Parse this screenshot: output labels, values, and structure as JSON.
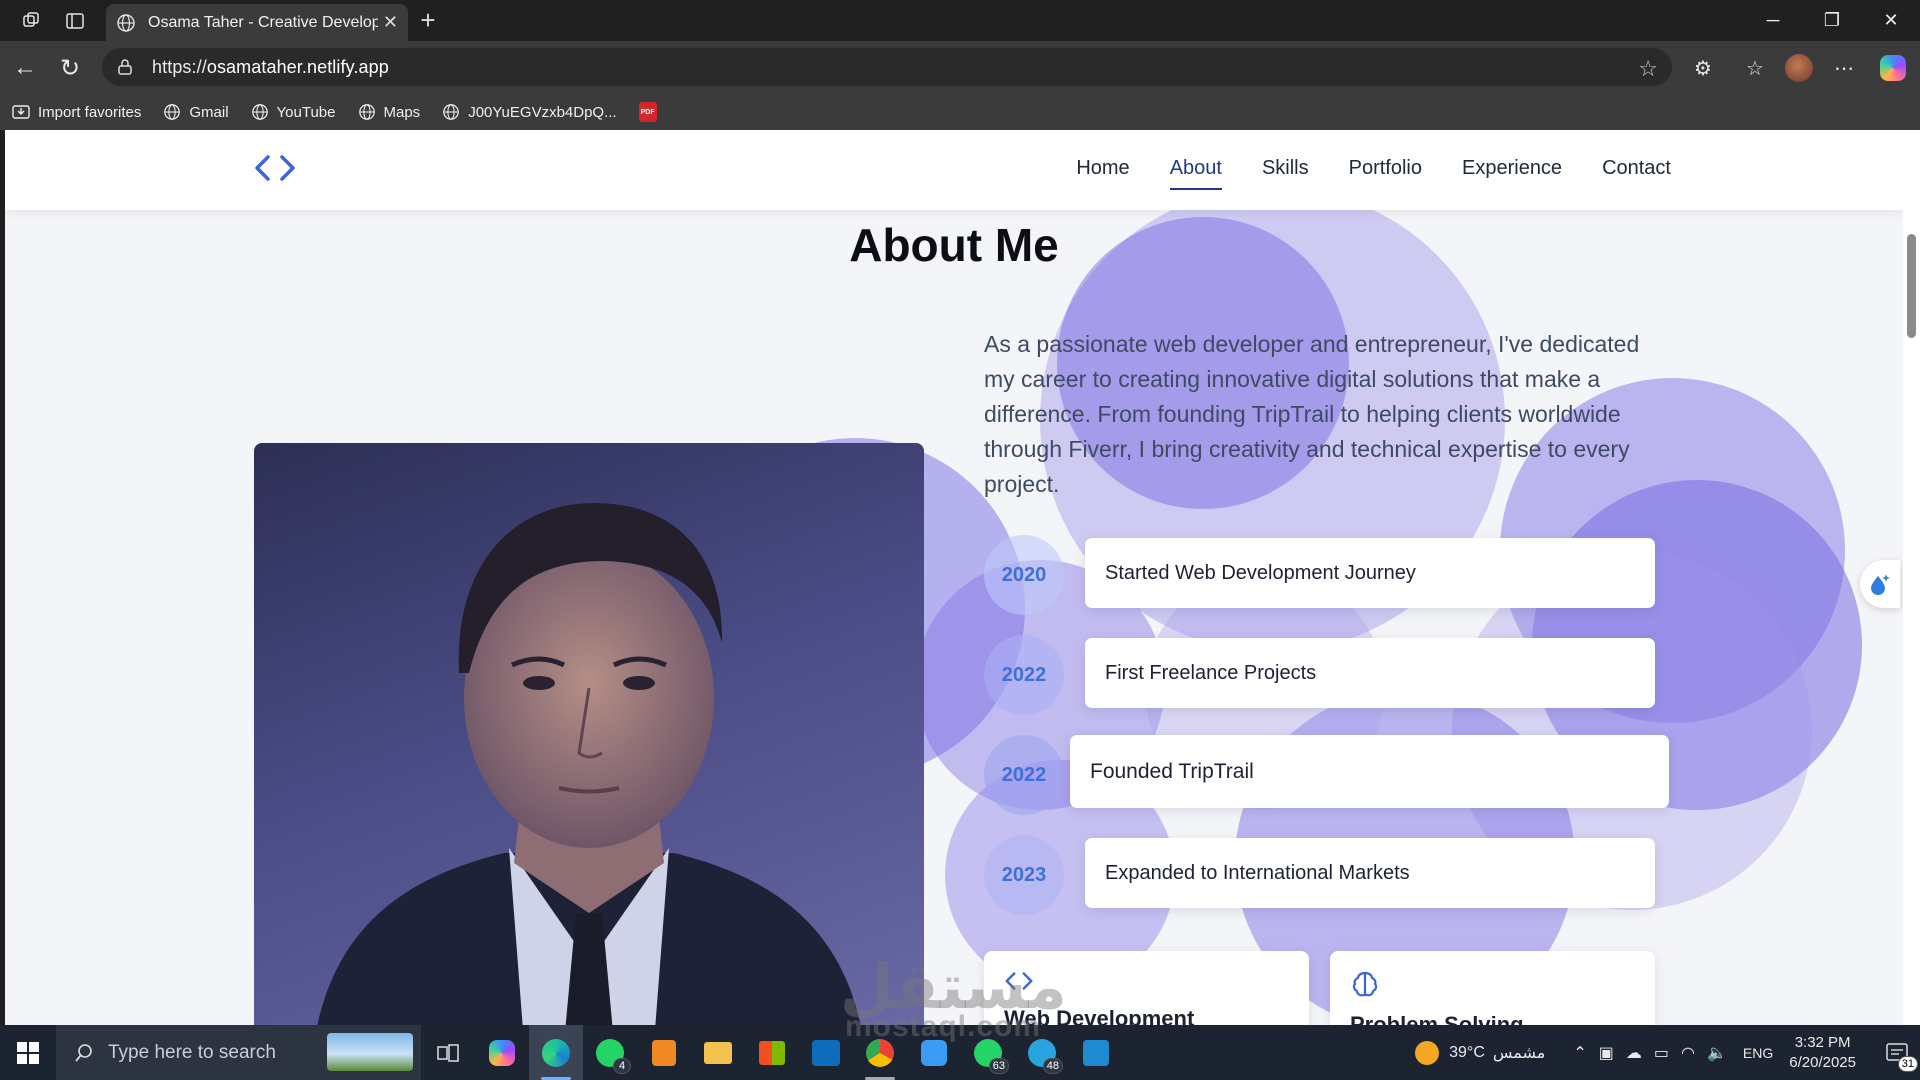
{
  "browser": {
    "tab_title": "Osama Taher - Creative Developer",
    "url_scheme": "https://",
    "url_host": "osamataher.netlify.app",
    "bookmarks": [
      {
        "label": "Import favorites",
        "icon": "import-icon"
      },
      {
        "label": "Gmail",
        "icon": "globe-icon"
      },
      {
        "label": "YouTube",
        "icon": "globe-icon"
      },
      {
        "label": "Maps",
        "icon": "globe-icon"
      },
      {
        "label": "J00YuEGVzxb4DpQ...",
        "icon": "globe-icon"
      }
    ]
  },
  "site": {
    "nav": [
      "Home",
      "About",
      "Skills",
      "Portfolio",
      "Experience",
      "Contact"
    ],
    "active_nav": "About",
    "section_title": "About Me",
    "bio": "As a passionate web developer and entrepreneur, I've dedicated my career to creating innovative digital solutions that make a difference. From founding TripTrail to helping clients worldwide through Fiverr, I bring creativity and technical expertise to every project.",
    "timeline": [
      {
        "year": "2020",
        "event": "Started Web Development Journey"
      },
      {
        "year": "2022",
        "event": "First Freelance Projects"
      },
      {
        "year": "2022",
        "event": "Founded TripTrail"
      },
      {
        "year": "2023",
        "event": "Expanded to International Markets"
      }
    ],
    "skill_cards": [
      {
        "label": "Web Development",
        "icon": "code-icon"
      },
      {
        "label": "Problem Solving",
        "icon": "brain-icon"
      }
    ],
    "accent_color": "#3f6fd8",
    "bubble_color": "#8f86e8"
  },
  "watermark": {
    "arabic": "مستقل",
    "latin": "mostaql.com"
  },
  "taskbar": {
    "search_placeholder": "Type here to search",
    "whatsapp_badge": "4",
    "whatsapp2_badge": "63",
    "telegram_badge": "48",
    "weather": "39°C",
    "weather_desc": "مشمس",
    "language": "ENG",
    "time": "3:32 PM",
    "date": "6/20/2025",
    "notifications": "31"
  }
}
